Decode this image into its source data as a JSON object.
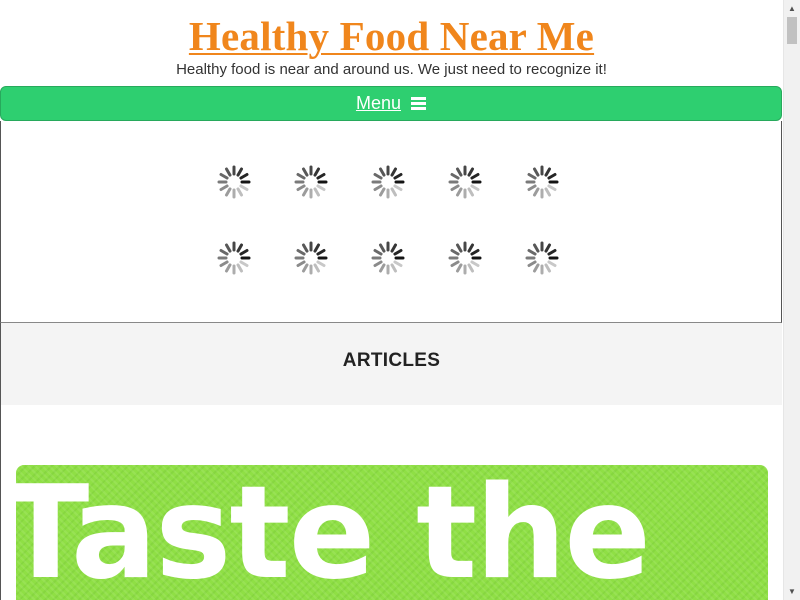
{
  "header": {
    "title": "Healthy Food Near Me",
    "tagline": "Healthy food is near and around us. We just need to recognize it!"
  },
  "menu": {
    "label": "Menu",
    "icon": "hamburger-icon"
  },
  "loading": {
    "icon": "loading-spinner-icon",
    "count": 10
  },
  "articles": {
    "heading": "ARTICLES",
    "featured_image_text": "Taste the"
  },
  "colors": {
    "title": "#f0861c",
    "menu_bar": "#2ecf70",
    "articles_band": "#f4f4f4",
    "image_bg": "#8fdf45"
  },
  "scrollbar": {
    "up_icon": "scroll-up-arrow-icon",
    "down_icon": "scroll-down-arrow-icon"
  }
}
